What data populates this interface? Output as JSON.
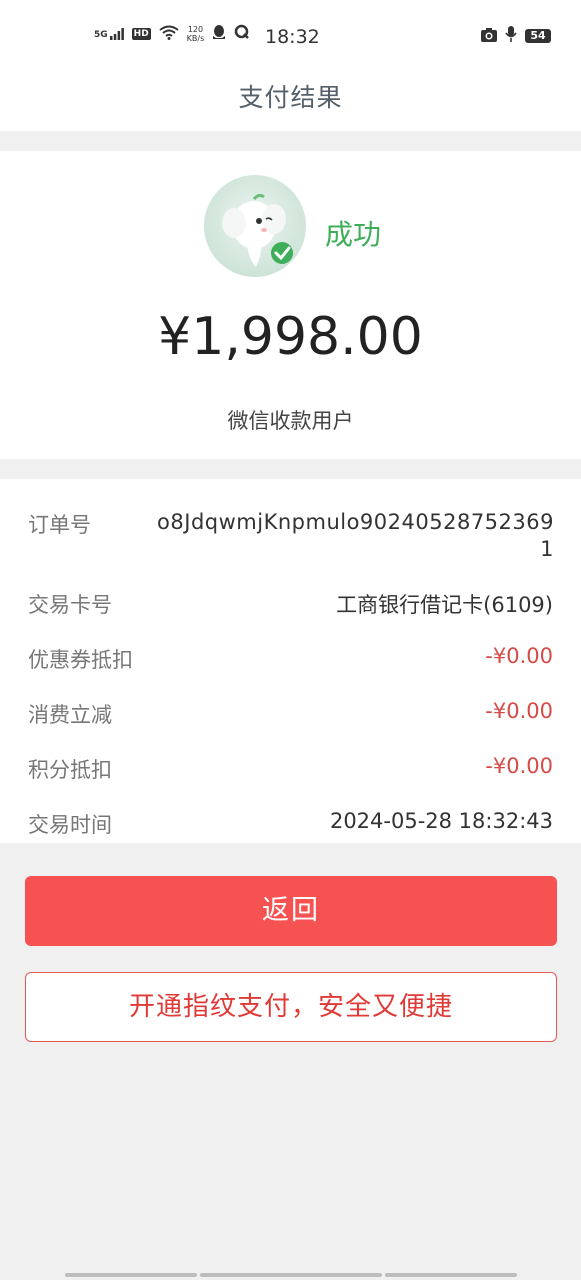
{
  "status_bar": {
    "network": "5G",
    "hd_badge": "HD",
    "speed_value": "120",
    "speed_unit": "KB/s",
    "time": "18:32",
    "battery": "54"
  },
  "nav": {
    "title": "支付结果"
  },
  "result": {
    "status": "成功",
    "amount": "¥1,998.00",
    "payee": "微信收款用户",
    "status_color": "#3fae5a"
  },
  "details": {
    "order_no_label": "订单号",
    "order_no_value": "o8JdqwmjKnpmulo902405287523691",
    "card_label": "交易卡号",
    "card_value": "工商银行借记卡(6109)",
    "coupon_label": "优惠券抵扣",
    "coupon_value": "-¥0.00",
    "discount_label": "消费立减",
    "discount_value": "-¥0.00",
    "points_label": "积分抵扣",
    "points_value": "-¥0.00",
    "time_label": "交易时间",
    "time_value": "2024-05-28 18:32:43"
  },
  "actions": {
    "back_label": "返回",
    "fingerprint_label": "开通指纹支付，安全又便捷",
    "back_color": "#f65252"
  }
}
